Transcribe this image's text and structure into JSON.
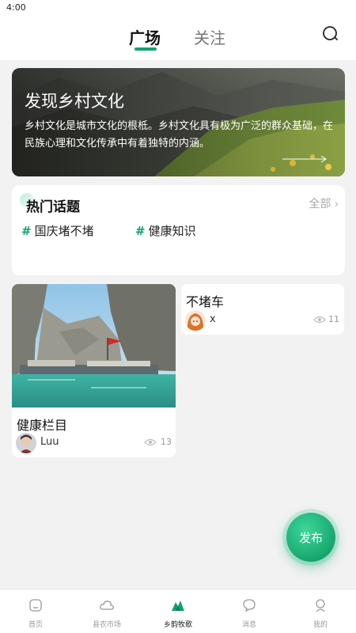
{
  "status_bar": {
    "time": "4:00"
  },
  "header": {
    "tabs": [
      {
        "label": "广场"
      },
      {
        "label": "关注"
      }
    ]
  },
  "banner": {
    "title": "发现乡村文化",
    "description": "乡村文化是城市文化的根柢。乡村文化具有极为广泛的群众基础，在民族心理和文化传承中有着独特的内涵。"
  },
  "hot_topics": {
    "title": "热门话题",
    "all_label": "全部",
    "topics": [
      {
        "label": "国庆堵不堵"
      },
      {
        "label": "健康知识"
      }
    ]
  },
  "posts": [
    {
      "title": "健康栏目",
      "author": "Luu",
      "views": "13"
    },
    {
      "title": "不堵车",
      "author": "x",
      "views": "11"
    }
  ],
  "publish_button": {
    "label": "发布"
  },
  "tabbar": {
    "items": [
      {
        "label": "首页",
        "icon": "home-icon"
      },
      {
        "label": "县农市场",
        "icon": "cloud-icon"
      },
      {
        "label": "乡韵牧歌",
        "icon": "mountain-icon"
      },
      {
        "label": "消息",
        "icon": "message-icon"
      },
      {
        "label": "我的",
        "icon": "user-icon"
      }
    ]
  },
  "colors": {
    "accent": "#13a36b",
    "background": "#f2f2f2"
  }
}
